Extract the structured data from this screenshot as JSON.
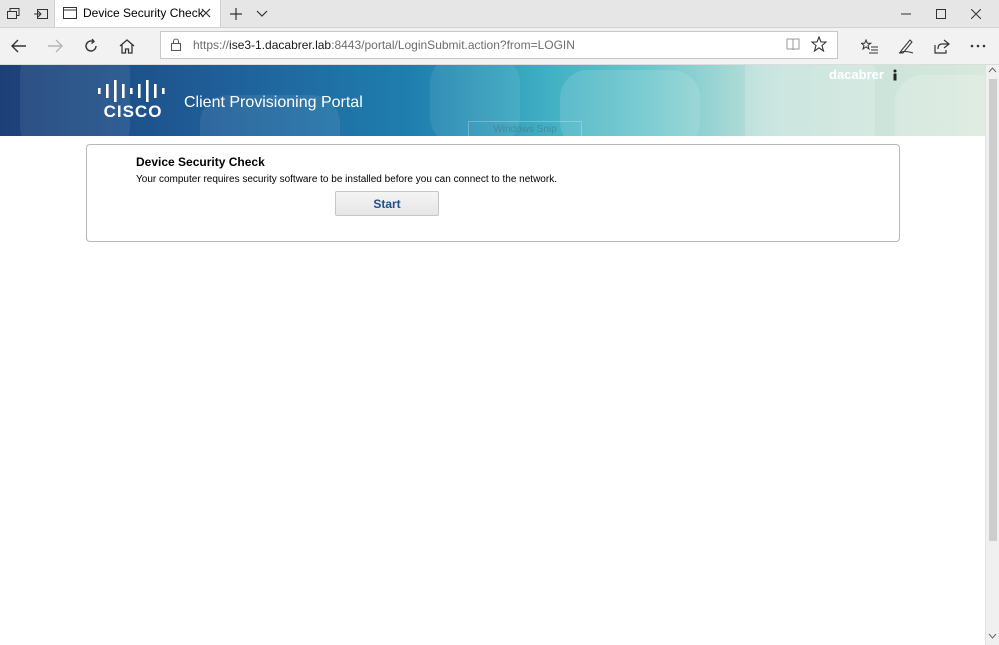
{
  "browser": {
    "tab": {
      "title": "Device Security Check"
    },
    "address_bar": {
      "scheme": "https://",
      "host": "ise3-1.dacabrer.lab",
      "rest": ":8443/portal/LoginSubmit.action?from=LOGIN"
    }
  },
  "page": {
    "banner": {
      "logo_text": "CISCO",
      "portal_title": "Client Provisioning Portal",
      "username": "dacabrer",
      "snip_overlay": "Windows Snip"
    },
    "card": {
      "title": "Device Security Check",
      "message": "Your computer requires security software to be installed before you can connect to the network.",
      "start_label": "Start"
    }
  },
  "colors": {
    "banner_start": "#1d3f78",
    "banner_end": "#d9e8dc",
    "button_text": "#1f4e8c"
  }
}
